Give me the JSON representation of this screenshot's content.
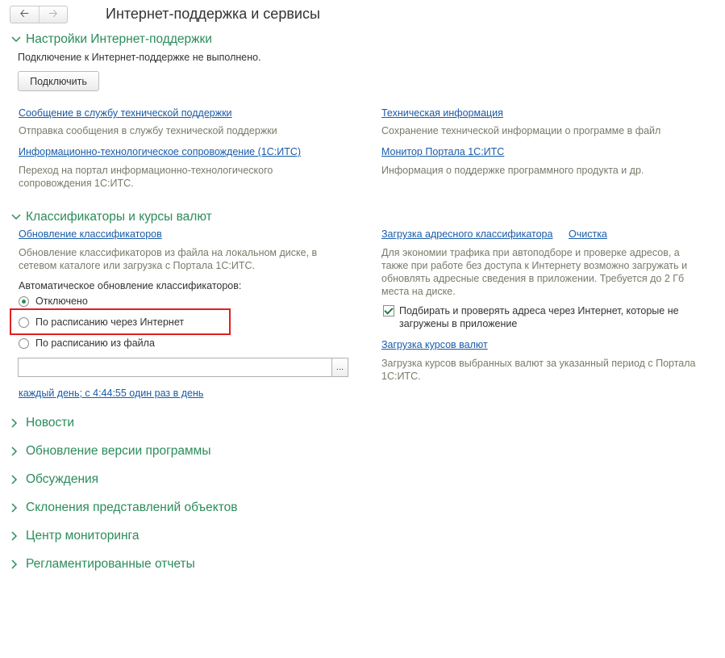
{
  "header": {
    "back_icon": "arrow-left-icon",
    "forward_icon": "arrow-right-icon",
    "title": "Интернет-поддержка и сервисы"
  },
  "settings": {
    "heading": "Настройки Интернет-поддержки",
    "status": "Подключение к Интернет-поддержке не выполнено.",
    "connect_label": "Подключить",
    "links": [
      {
        "title": "Сообщение в службу технической поддержки",
        "desc": "Отправка сообщения в службу технической поддержки"
      },
      {
        "title": "Информационно-технологическое сопровождение (1С:ИТС)",
        "desc": "Переход на портал информационно-технологического сопровождения 1С:ИТС."
      },
      {
        "title": "Техническая информация",
        "desc": "Сохранение технической информации о программе в файл"
      },
      {
        "title": "Монитор Портала 1С:ИТС",
        "desc": "Информация о поддержке программного продукта и др."
      }
    ]
  },
  "classifiers": {
    "heading": "Классификаторы и курсы валют",
    "update_link": "Обновление классификаторов",
    "update_desc": "Обновление классификаторов из файла на локальном диске, в сетевом каталоге или загрузка с Портала 1С:ИТС.",
    "auto_label": "Автоматическое обновление классификаторов:",
    "options": [
      {
        "label": "Отключено",
        "selected": true
      },
      {
        "label": "По расписанию через Интернет",
        "selected": false
      },
      {
        "label": "По расписанию из файла",
        "selected": false
      }
    ],
    "file_path": "",
    "browse_label": "...",
    "schedule_link": "каждый день; с 4:44:55 один раз в день",
    "address_link": "Загрузка адресного классификатора",
    "clear_link": "Очистка",
    "address_desc": "Для экономии трафика при автоподборе и проверке адресов, а также при работе без доступа к Интернету возможно загружать и обновлять адресные сведения в приложении. Требуется до 2 Гб места на диске.",
    "address_check_label": "Подбирать и проверять адреса через Интернет, которые не загружены в приложение",
    "address_check_checked": true,
    "rates_link": "Загрузка курсов валют",
    "rates_desc": "Загрузка курсов выбранных валют за указанный период с Портала 1С:ИТС."
  },
  "collapsed_sections": [
    "Новости",
    "Обновление версии программы",
    "Обсуждения",
    "Склонения представлений объектов",
    "Центр мониторинга",
    "Регламентированные отчеты"
  ],
  "colors": {
    "section_green": "#2b8c5a",
    "link_blue": "#1a5ca8",
    "highlight_red": "#e02020"
  }
}
